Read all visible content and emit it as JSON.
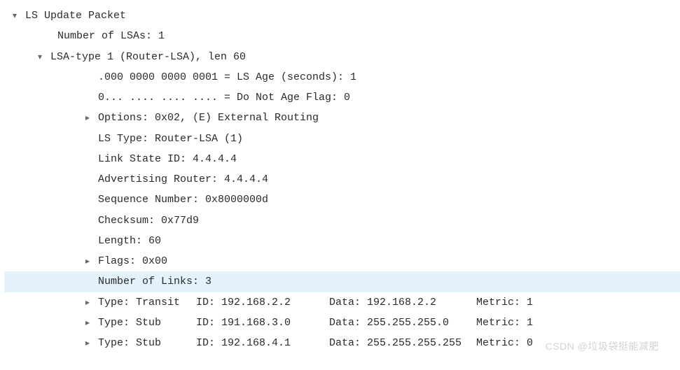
{
  "tree": {
    "root": "LS Update Packet",
    "num_lsas": "Number of LSAs: 1",
    "lsa_header": "LSA-type 1 (Router-LSA), len 60",
    "ls_age": ".000 0000 0000 0001 = LS Age (seconds): 1",
    "dna_flag": "0... .... .... .... = Do Not Age Flag: 0",
    "options": "Options: 0x02, (E) External Routing",
    "ls_type": "LS Type: Router-LSA (1)",
    "ls_id": "Link State ID: 4.4.4.4",
    "adv_rtr": "Advertising Router: 4.4.4.4",
    "seq": "Sequence Number: 0x8000000d",
    "cksum": "Checksum: 0x77d9",
    "length": "Length: 60",
    "flags": "Flags: 0x00",
    "num_links": "Number of Links: 3",
    "links": [
      {
        "type": "Type: Transit",
        "id": "ID: 192.168.2.2",
        "data": "Data: 192.168.2.2",
        "metric": "Metric: 1"
      },
      {
        "type": "Type: Stub",
        "id": "ID: 191.168.3.0",
        "data": "Data: 255.255.255.0",
        "metric": "Metric: 1"
      },
      {
        "type": "Type: Stub",
        "id": "ID: 192.168.4.1",
        "data": "Data: 255.255.255.255",
        "metric": "Metric: 0"
      }
    ]
  },
  "watermark": "CSDN @垃圾袋挺能减肥"
}
